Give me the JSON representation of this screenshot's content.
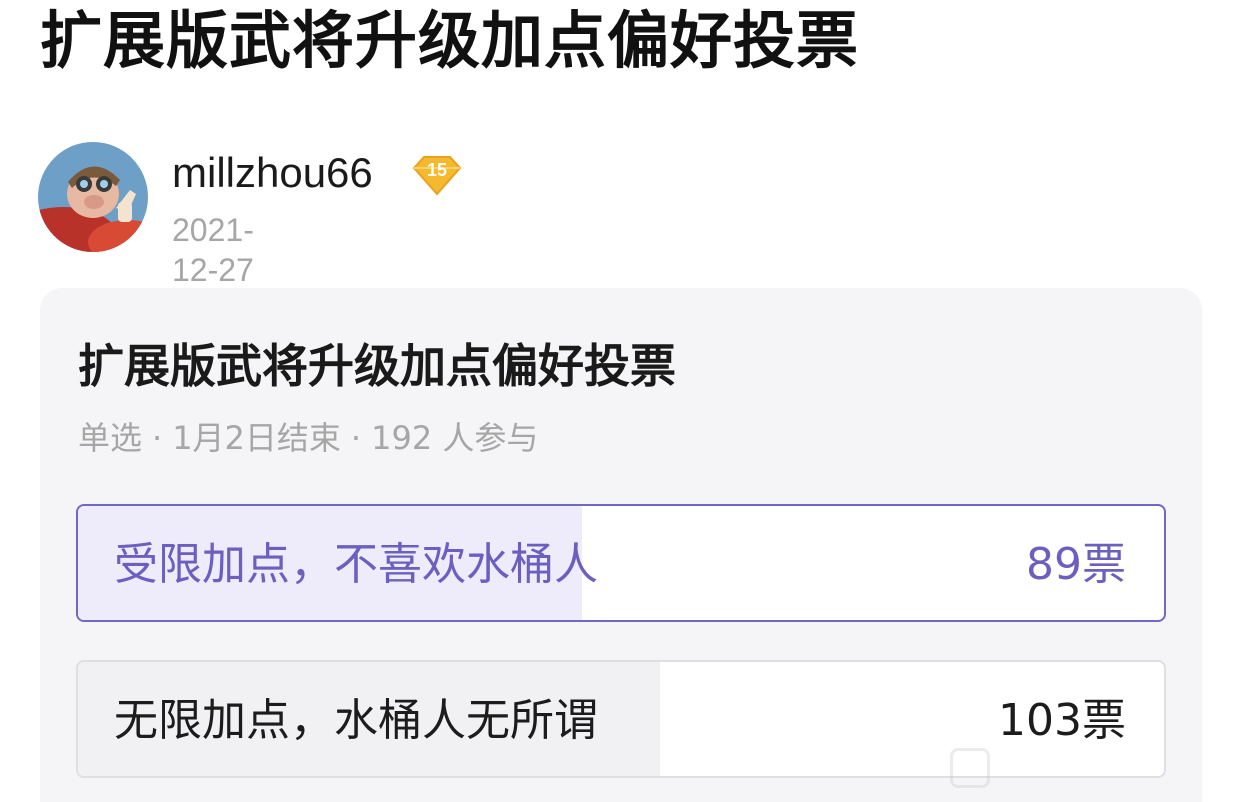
{
  "post": {
    "title": "扩展版武将升级加点偏好投票"
  },
  "author": {
    "name": "millzhou66",
    "level": "15",
    "date": "2021-12-27",
    "avatar_icon": "pilot-pig-avatar",
    "badge_color": "#f5b82e"
  },
  "poll": {
    "title": "扩展版武将升级加点偏好投票",
    "type": "单选",
    "end": "1月2日结束",
    "participants": "192 人参与",
    "accent_color": "#6c5fc0",
    "options": [
      {
        "label": "受限加点，不喜欢水桶人",
        "votes": "89票",
        "share": 0.464,
        "selected": true
      },
      {
        "label": "无限加点，水桶人无所谓",
        "votes": "103票",
        "share": 0.536,
        "selected": false
      }
    ]
  }
}
